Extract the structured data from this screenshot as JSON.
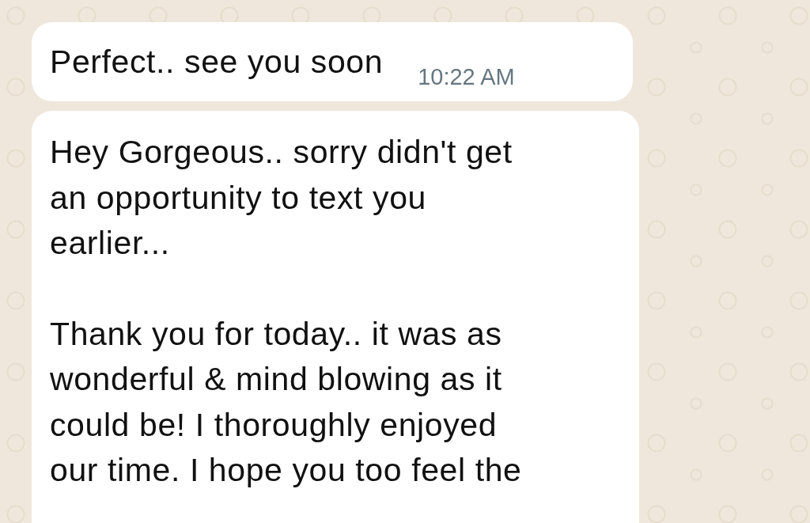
{
  "messages": [
    {
      "kind": "short",
      "paragraphs": [
        [
          "Perfect.. see you soon"
        ]
      ],
      "time": "10:22 AM"
    },
    {
      "kind": "long",
      "paragraphs": [
        [
          "Hey Gorgeous.. sorry didn't get",
          "an opportunity to text you",
          "earlier..."
        ],
        [
          "Thank you for today.. it was as",
          "wonderful & mind blowing as it",
          "could be! I thoroughly enjoyed",
          "our time. I hope you too feel the"
        ]
      ]
    }
  ]
}
